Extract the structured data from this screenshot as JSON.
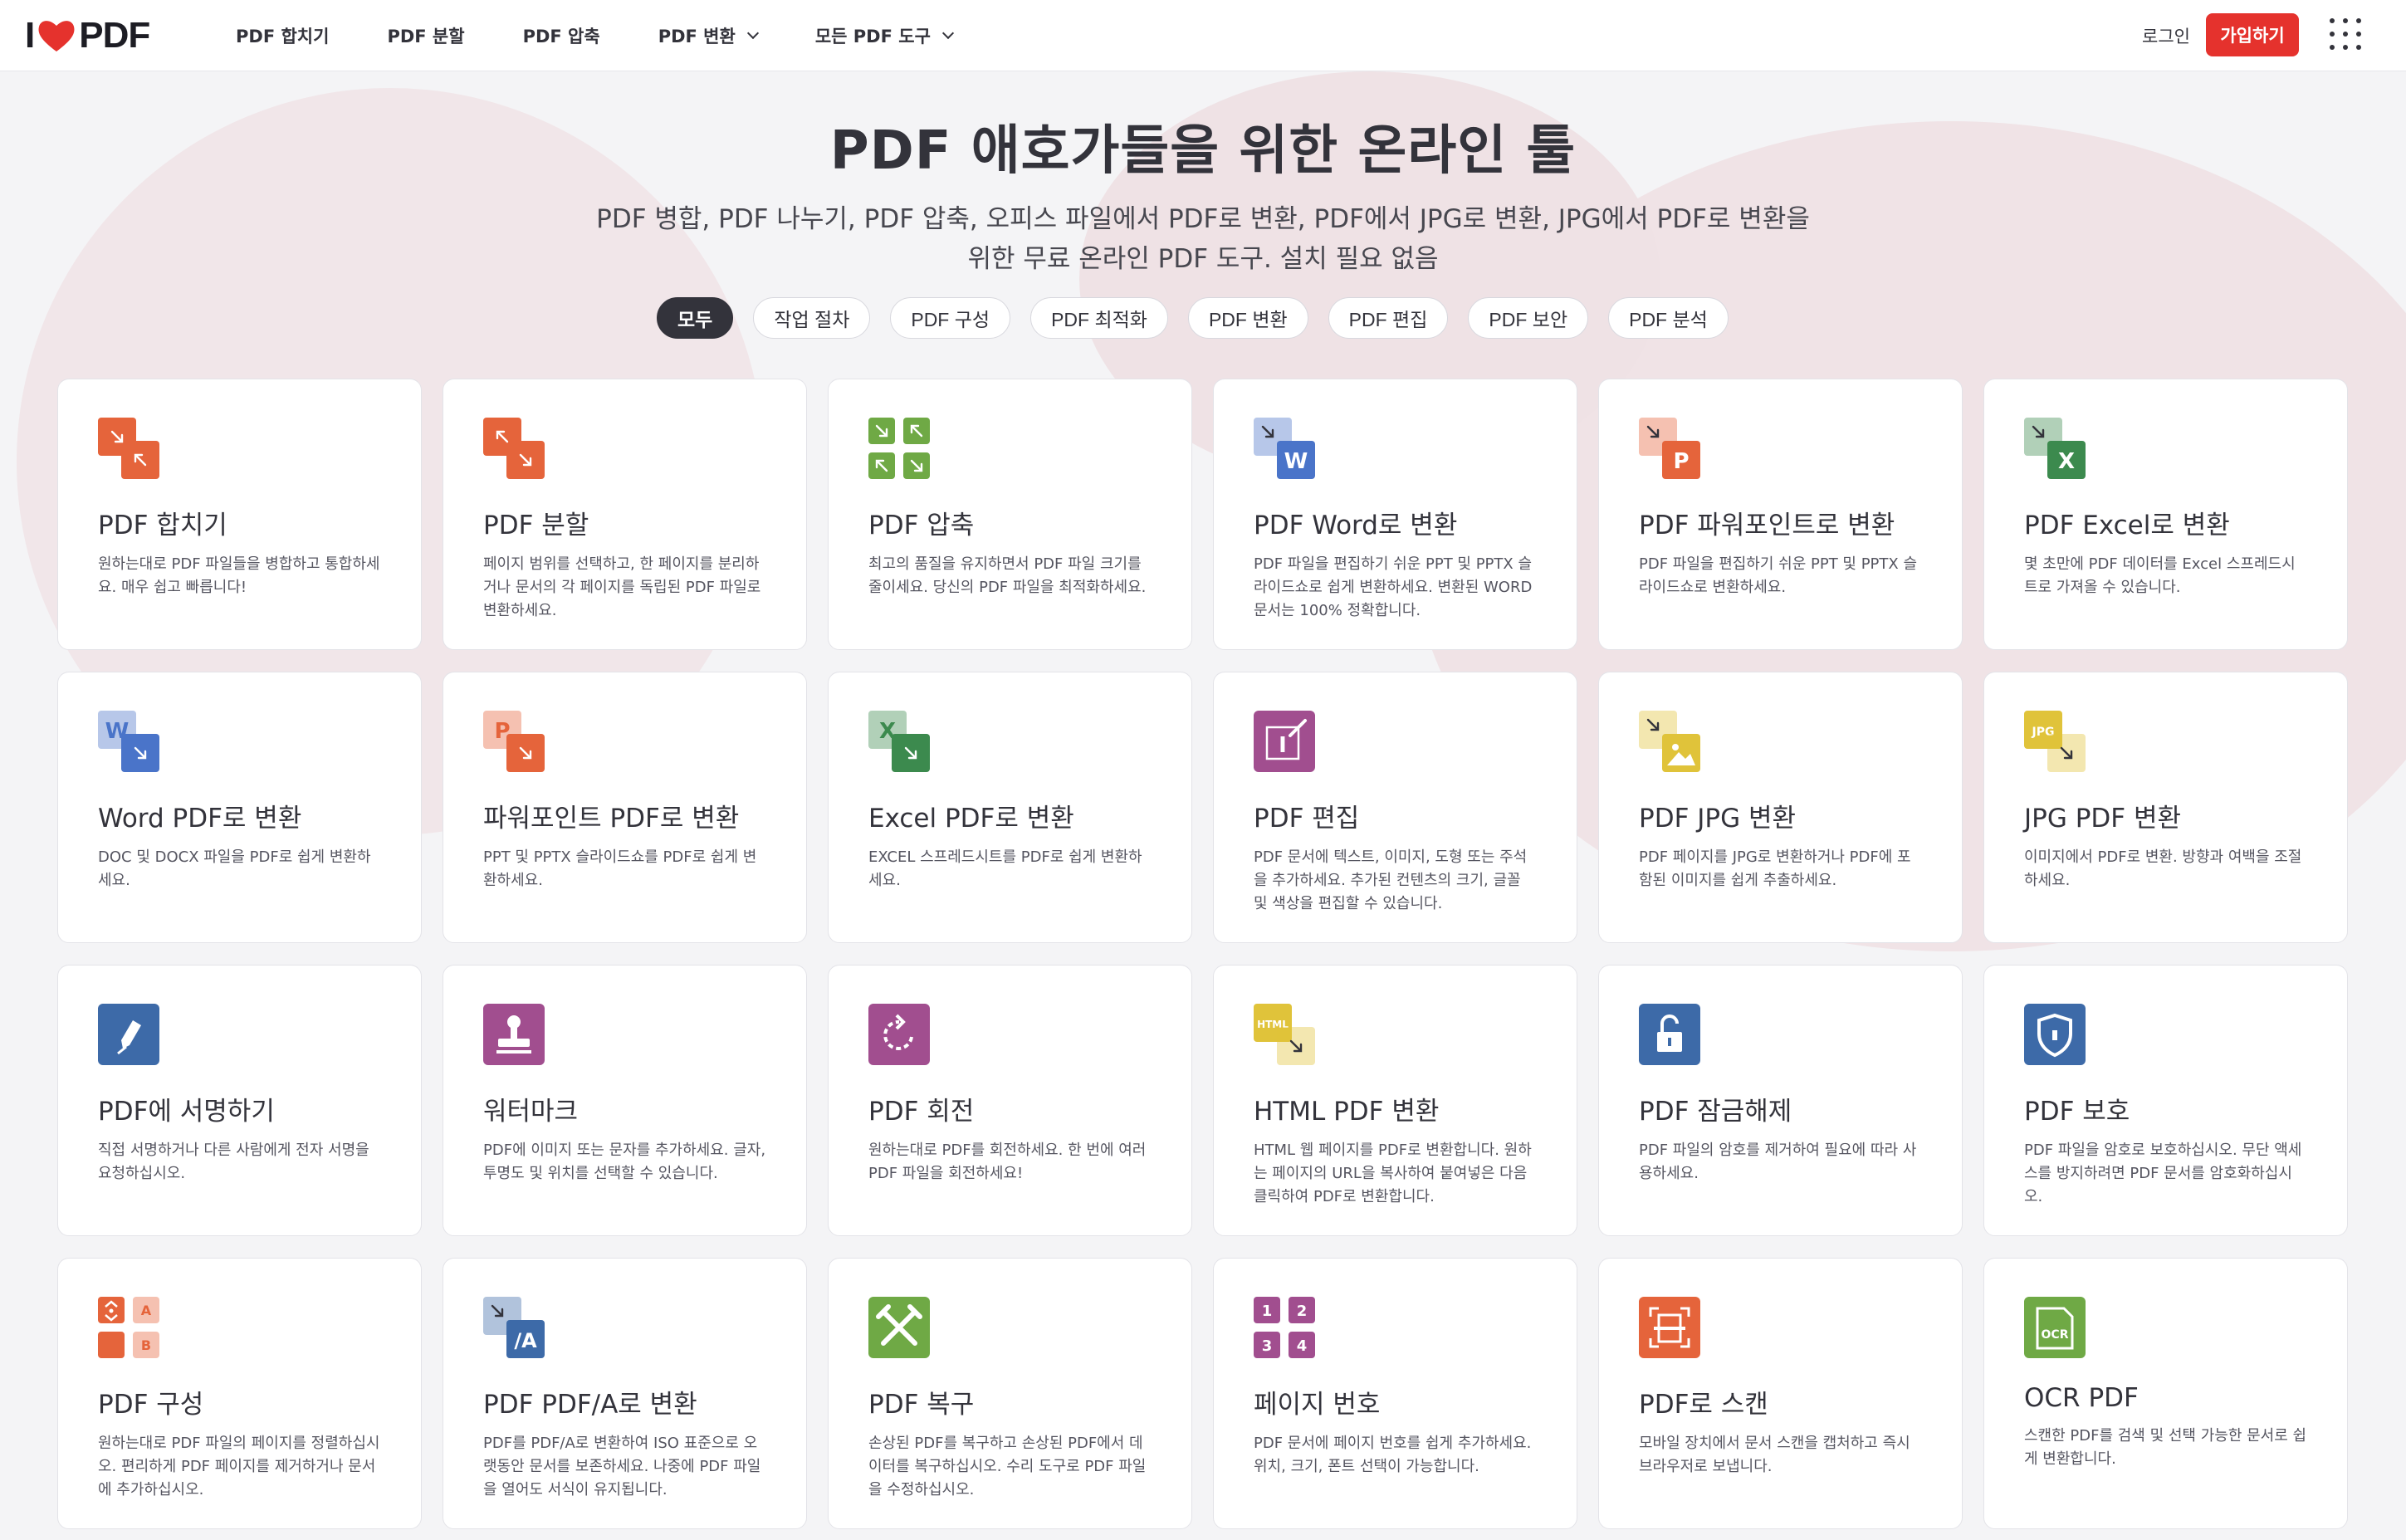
{
  "brand": {
    "left": "I",
    "right": "PDF",
    "accent": "#e5322d"
  },
  "nav": [
    {
      "label": "PDF 합치기",
      "chevron": false
    },
    {
      "label": "PDF 분할",
      "chevron": false
    },
    {
      "label": "PDF 압축",
      "chevron": false
    },
    {
      "label": "PDF 변환",
      "chevron": true
    },
    {
      "label": "모든 PDF 도구",
      "chevron": true
    }
  ],
  "header": {
    "login": "로그인",
    "signup": "가입하기",
    "apps_icon": "grid-apps-icon"
  },
  "hero": {
    "title": "PDF 애호가들을 위한 온라인 툴",
    "subtitle": "PDF 병합, PDF 나누기, PDF 압축, 오피스 파일에서 PDF로 변환, PDF에서 JPG로 변환, JPG에서 PDF로 변환을 위한 무료 온라인 PDF 도구. 설치 필요 없음"
  },
  "filters": [
    {
      "label": "모두",
      "active": true
    },
    {
      "label": "작업 절차",
      "active": false
    },
    {
      "label": "PDF 구성",
      "active": false
    },
    {
      "label": "PDF 최적화",
      "active": false
    },
    {
      "label": "PDF 변환",
      "active": false
    },
    {
      "label": "PDF 편집",
      "active": false
    },
    {
      "label": "PDF 보안",
      "active": false
    },
    {
      "label": "PDF 분석",
      "active": false
    }
  ],
  "tools": [
    {
      "id": "merge",
      "title": "PDF 합치기",
      "desc": "원하는대로 PDF 파일들을 병합하고 통합하세요. 매우 쉽고 빠릅니다!",
      "icon": "merge-icon",
      "color": "#e5643b"
    },
    {
      "id": "split",
      "title": "PDF 분할",
      "desc": "페이지 범위를 선택하고, 한 페이지를 분리하거나 문서의 각 페이지를 독립된 PDF 파일로 변환하세요.",
      "icon": "split-icon",
      "color": "#e5643b"
    },
    {
      "id": "compress",
      "title": "PDF 압축",
      "desc": "최고의 품질을 유지하면서 PDF 파일 크기를 줄이세요. 당신의 PDF 파일을 최적화하세요.",
      "icon": "compress-icon",
      "color": "#6fa945"
    },
    {
      "id": "pdf-word",
      "title": "PDF Word로 변환",
      "desc": "PDF 파일을 편집하기 쉬운 PPT 및 PPTX 슬라이드쇼로 쉽게 변환하세요. 변환된 WORD 문서는 100% 정확합니다.",
      "icon": "pdf-to-word-icon",
      "color": "#4a74c9",
      "letter": "W"
    },
    {
      "id": "pdf-ppt",
      "title": "PDF 파워포인트로 변환",
      "desc": "PDF 파일을 편집하기 쉬운 PPT 및 PPTX 슬라이드쇼로 변환하세요.",
      "icon": "pdf-to-powerpoint-icon",
      "color": "#e5643b",
      "letter": "P"
    },
    {
      "id": "pdf-excel",
      "title": "PDF Excel로 변환",
      "desc": "몇 초만에 PDF 데이터를 Excel 스프레드시트로 가져올 수 있습니다.",
      "icon": "pdf-to-excel-icon",
      "color": "#3c8a4e",
      "letter": "X"
    },
    {
      "id": "word-pdf",
      "title": "Word PDF로 변환",
      "desc": "DOC 및 DOCX 파일을 PDF로 쉽게 변환하세요.",
      "icon": "word-to-pdf-icon",
      "color": "#4a74c9",
      "letter": "W"
    },
    {
      "id": "ppt-pdf",
      "title": "파워포인트 PDF로 변환",
      "desc": "PPT 및 PPTX 슬라이드쇼를 PDF로 쉽게 변환하세요.",
      "icon": "powerpoint-to-pdf-icon",
      "color": "#e5643b",
      "letter": "P"
    },
    {
      "id": "excel-pdf",
      "title": "Excel PDF로 변환",
      "desc": "EXCEL 스프레드시트를 PDF로 쉽게 변환하세요.",
      "icon": "excel-to-pdf-icon",
      "color": "#3c8a4e",
      "letter": "X"
    },
    {
      "id": "edit",
      "title": "PDF 편집",
      "desc": "PDF 문서에 텍스트, 이미지, 도형 또는 주석을 추가하세요. 추가된 컨텐츠의 크기, 글꼴 및 색상을 편집할 수 있습니다.",
      "icon": "edit-pdf-icon",
      "color": "#a14e8f"
    },
    {
      "id": "pdf-jpg",
      "title": "PDF JPG 변환",
      "desc": "PDF 페이지를 JPG로 변환하거나 PDF에 포함된 이미지를 쉽게 추출하세요.",
      "icon": "pdf-to-jpg-icon",
      "color": "#e0c33a"
    },
    {
      "id": "jpg-pdf",
      "title": "JPG PDF 변환",
      "desc": "이미지에서 PDF로 변환. 방향과 여백을 조절하세요.",
      "icon": "jpg-to-pdf-icon",
      "color": "#e0c33a",
      "letter": "JPG"
    },
    {
      "id": "sign",
      "title": "PDF에 서명하기",
      "desc": "직접 서명하거나 다른 사람에게 전자 서명을 요청하십시오.",
      "icon": "sign-pen-icon",
      "color": "#3d6aa8"
    },
    {
      "id": "watermark",
      "title": "워터마크",
      "desc": "PDF에 이미지 또는 문자를 추가하세요. 글자, 투명도 및 위치를 선택할 수 있습니다.",
      "icon": "watermark-stamp-icon",
      "color": "#a14e8f"
    },
    {
      "id": "rotate",
      "title": "PDF 회전",
      "desc": "원하는대로 PDF를 회전하세요. 한 번에 여러 PDF 파일을 회전하세요!",
      "icon": "rotate-icon",
      "color": "#a14e8f"
    },
    {
      "id": "html-pdf",
      "title": "HTML PDF 변환",
      "desc": "HTML 웹 페이지를 PDF로 변환합니다. 원하는 페이지의 URL을 복사하여 붙여넣은 다음 클릭하여 PDF로 변환합니다.",
      "icon": "html-to-pdf-icon",
      "color": "#e0c33a",
      "letter": "HTML"
    },
    {
      "id": "unlock",
      "title": "PDF 잠금해제",
      "desc": "PDF 파일의 암호를 제거하여 필요에 따라 사용하세요.",
      "icon": "unlock-icon",
      "color": "#3d6aa8"
    },
    {
      "id": "protect",
      "title": "PDF 보호",
      "desc": "PDF 파일을 암호로 보호하십시오. 무단 액세스를 방지하려면 PDF 문서를 암호화하십시오.",
      "icon": "protect-shield-icon",
      "color": "#3d6aa8"
    },
    {
      "id": "organize",
      "title": "PDF 구성",
      "desc": "원하는대로 PDF 파일의 페이지를 정렬하십시오. 편리하게 PDF 페이지를 제거하거나 문서에 추가하십시오.",
      "icon": "organize-icon",
      "color": "#e5643b",
      "letters": [
        "A",
        "B"
      ]
    },
    {
      "id": "pdfa",
      "title": "PDF PDF/A로 변환",
      "desc": "PDF를 PDF/A로 변환하여 ISO 표준으로 오랫동안 문서를 보존하세요. 나중에 PDF 파일을 열어도 서식이 유지됩니다.",
      "icon": "pdf-to-pdfa-icon",
      "color": "#3d6aa8",
      "letter": "/A"
    },
    {
      "id": "repair",
      "title": "PDF 복구",
      "desc": "손상된 PDF를 복구하고 손상된 PDF에서 데이터를 복구하십시오. 수리 도구로 PDF 파일을 수정하십시오.",
      "icon": "repair-tools-icon",
      "color": "#6fa945"
    },
    {
      "id": "page-numbers",
      "title": "페이지 번호",
      "desc": "PDF 문서에 페이지 번호를 쉽게 추가하세요. 위치, 크기, 폰트 선택이 가능합니다.",
      "icon": "page-numbers-icon",
      "color": "#a14e8f",
      "letters": [
        "1",
        "2",
        "3",
        "4"
      ]
    },
    {
      "id": "scan",
      "title": "PDF로 스캔",
      "desc": "모바일 장치에서 문서 스캔을 캡처하고 즉시 브라우저로 보냅니다.",
      "icon": "scan-icon",
      "color": "#e5643b"
    },
    {
      "id": "ocr",
      "title": "OCR PDF",
      "desc": "스캔한 PDF를 검색 및 선택 가능한 문서로 쉽게 변환합니다.",
      "icon": "ocr-icon",
      "color": "#6fa945",
      "letter": "OCR"
    }
  ]
}
